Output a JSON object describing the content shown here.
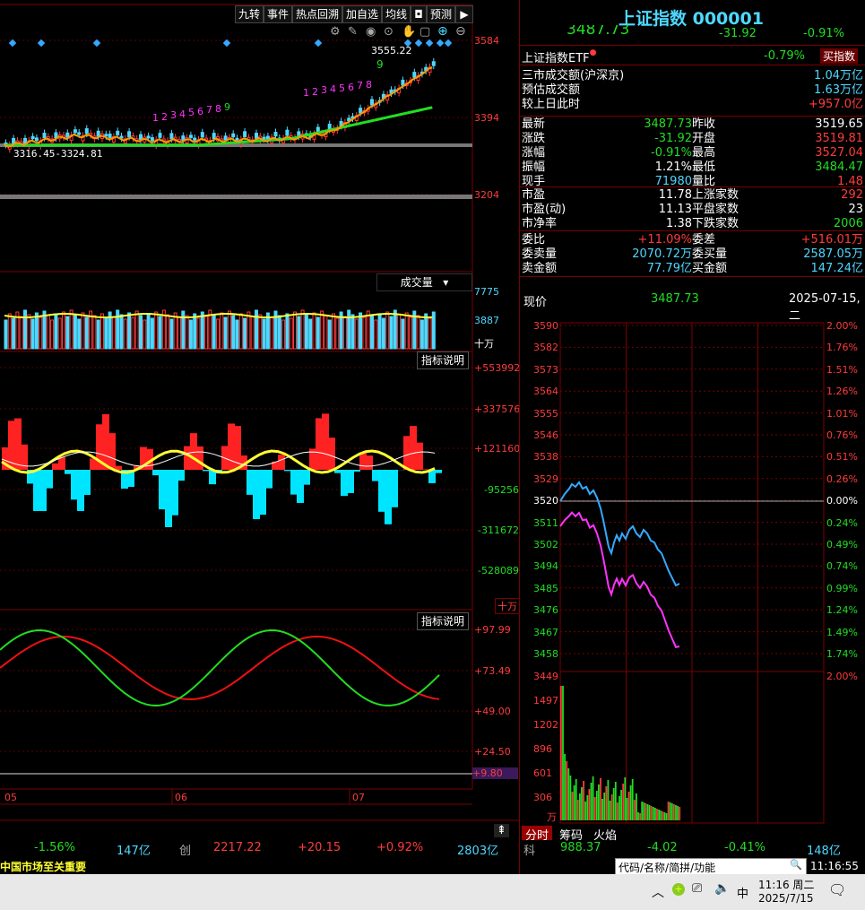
{
  "toolbar": {
    "buttons": [
      "九转",
      "事件",
      "热点回溯",
      "加自选",
      "均线",
      "预测"
    ]
  },
  "kchart": {
    "right_axis": [
      "3584",
      "3394",
      "3204"
    ],
    "high_label": "3555.22",
    "nine_label": "9",
    "range_label": "3316.45-3324.81",
    "seq_a": [
      "1",
      "2",
      "3",
      "4",
      "5",
      "6",
      "7",
      "8",
      "9"
    ],
    "seq_b": [
      "1",
      "2",
      "3",
      "4",
      "5",
      "6",
      "7",
      "8"
    ]
  },
  "volume": {
    "title": "成交量",
    "axis": [
      "7775",
      "3887"
    ],
    "unit": "十万"
  },
  "macd": {
    "btn": "指标说明",
    "axis": [
      "+553992",
      "+337576",
      "+121160",
      "-95256",
      "-311672",
      "-528089"
    ],
    "unit": "十万"
  },
  "kdj": {
    "btn": "指标说明",
    "axis": [
      "+97.99",
      "+73.49",
      "+49.00",
      "+24.50"
    ],
    "cur": "+9.80"
  },
  "months": [
    "05",
    "06",
    "07"
  ],
  "bottom_left": {
    "pct": "-1.56%",
    "amount": "147亿",
    "name": "创",
    "price": "2217.22",
    "chg": "+20.15",
    "chgpct": "+0.92%",
    "vol": "2803亿"
  },
  "ticker": "中国市场至关重要",
  "panel": {
    "title": "上证指数 000001",
    "price_partial": "3487.73",
    "chg": "-31.92",
    "chgpct": "-0.91%",
    "etf_name": "上证指数ETF",
    "etf_pct": "-0.79%",
    "etf_btn": "买指数",
    "stats": [
      {
        "k": "三市成交额(沪深京)",
        "v": "1.04万亿"
      },
      {
        "k": "预估成交额",
        "v": "1.63万亿"
      },
      {
        "k": "较上日此时",
        "v": "+957.0亿"
      }
    ],
    "quote": [
      {
        "k1": "最新",
        "v1": "3487.73",
        "k2": "昨收",
        "v2": "3519.65"
      },
      {
        "k1": "涨跌",
        "v1": "-31.92",
        "k2": "开盘",
        "v2": "3519.81"
      },
      {
        "k1": "涨幅",
        "v1": "-0.91%",
        "k2": "最高",
        "v2": "3527.04"
      },
      {
        "k1": "振幅",
        "v1": "1.21%",
        "k2": "最低",
        "v2": "3484.47"
      },
      {
        "k1": "现手",
        "v1": "71980",
        "k2": "量比",
        "v2": "1.48"
      }
    ],
    "val": [
      {
        "k1": "市盈",
        "v1": "11.78",
        "k2": "上涨家数",
        "v2": "292"
      },
      {
        "k1": "市盈(动)",
        "v1": "11.13",
        "k2": "平盘家数",
        "v2": "23"
      },
      {
        "k1": "市净率",
        "v1": "1.38",
        "k2": "下跌家数",
        "v2": "2006"
      }
    ],
    "order": [
      {
        "k1": "委比",
        "v1": "+11.09%",
        "k2": "委差",
        "v2": "+516.01万"
      },
      {
        "k1": "委卖量",
        "v1": "2070.72万",
        "k2": "委买量",
        "v2": "2587.05万"
      },
      {
        "k1": "卖金额",
        "v1": "77.79亿",
        "k2": "买金额",
        "v2": "147.24亿"
      }
    ],
    "now_label": "现价",
    "now_value": "3487.73",
    "date": "2025-07-15,二"
  },
  "intraday": {
    "left_axis": [
      "3590",
      "3582",
      "3573",
      "3564",
      "3555",
      "3546",
      "3538",
      "3529",
      "3520",
      "3511",
      "3502",
      "3494",
      "3485",
      "3476",
      "3467",
      "3458"
    ],
    "right_axis": [
      "2.00%",
      "1.76%",
      "1.51%",
      "1.26%",
      "1.01%",
      "0.76%",
      "0.51%",
      "0.26%",
      "0.00%",
      "0.24%",
      "0.49%",
      "0.74%",
      "0.99%",
      "1.24%",
      "1.49%",
      "1.74%"
    ],
    "vol_axis": [
      "3449",
      "1497",
      "1202",
      "896",
      "601",
      "306",
      "万"
    ],
    "vol_right": "2.00%",
    "tabs": [
      "分时",
      "筹码",
      "火焰"
    ]
  },
  "bottom_right": {
    "name": "科",
    "price": "988.37",
    "chg": "-4.02",
    "pct": "-0.41%",
    "amount": "148亿"
  },
  "searchbar": {
    "placeholder": "代码/名称/简拼/功能",
    "time": "11:16:55"
  },
  "taskbar": {
    "ime": "中",
    "time": "11:16 周二",
    "date": "2025/7/15"
  },
  "colors": {
    "up": "#ff3b3b",
    "down": "#22dd22",
    "accent": "#4ed8ff",
    "grid": "#7a0000"
  }
}
